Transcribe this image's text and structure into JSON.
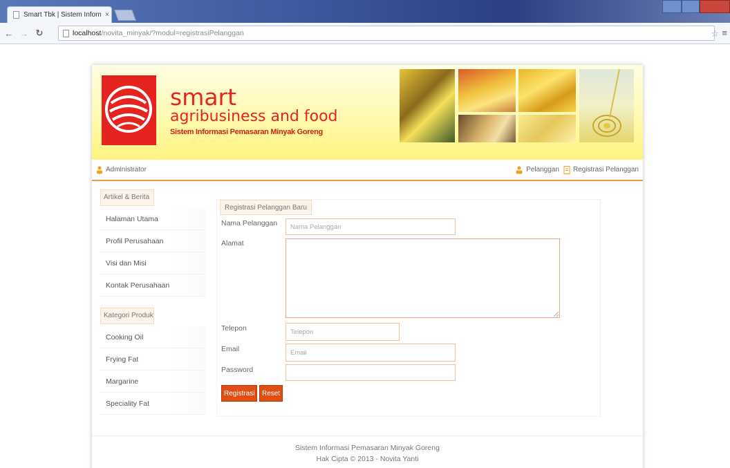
{
  "browser": {
    "tab_title": "Smart Tbk | Sistem Inform",
    "tab_close": "×",
    "url_host": "localhost",
    "url_path": "/novita_minyak/?modul=registrasiPelanggan"
  },
  "header": {
    "brand_name": "smart",
    "brand_sub": "agribusiness and food",
    "brand_tag": "Sistem Informasi Pemasaran Minyak Goreng"
  },
  "userbar": {
    "admin": "Administrator",
    "links": [
      "Pelanggan",
      "Registrasi Pelanggan"
    ]
  },
  "sidebar": {
    "sections": [
      {
        "title": "Artikel & Berita",
        "items": [
          "Halaman Utama",
          "Profil Perusahaan",
          "Visi dan Misi",
          "Kontak Perusahaan"
        ]
      },
      {
        "title": "Kategori Produk",
        "items": [
          "Cooking Oil",
          "Frying Fat",
          "Margarine",
          "Speciality Fat"
        ]
      }
    ]
  },
  "form": {
    "title": "Registrasi Pelanggan Baru",
    "fields": {
      "nama": {
        "label": "Nama Pelanggan",
        "placeholder": "Nama Pelanggan",
        "value": ""
      },
      "alamat": {
        "label": "Alamat",
        "value": ""
      },
      "telepon": {
        "label": "Telepon",
        "placeholder": "Telepon",
        "value": ""
      },
      "email": {
        "label": "Email",
        "placeholder": "Email",
        "value": ""
      },
      "password": {
        "label": "Password",
        "placeholder": "",
        "value": ""
      }
    },
    "buttons": {
      "submit": "Registrasi",
      "reset": "Reset"
    }
  },
  "footer": {
    "line1": "Sistem Informasi Pemasaran Minyak Goreng",
    "line2": "Hak Cipta © 2013 - Novita Yanti"
  },
  "colors": {
    "brand_red": "#e52420",
    "accent_orange": "#e04e13",
    "banner_yellow": "#fff380"
  },
  "icons": [
    "page-icon",
    "back-icon",
    "forward-icon",
    "reload-icon",
    "star-icon",
    "menu-icon",
    "user-icon",
    "users-icon",
    "document-icon",
    "logo-icon"
  ]
}
